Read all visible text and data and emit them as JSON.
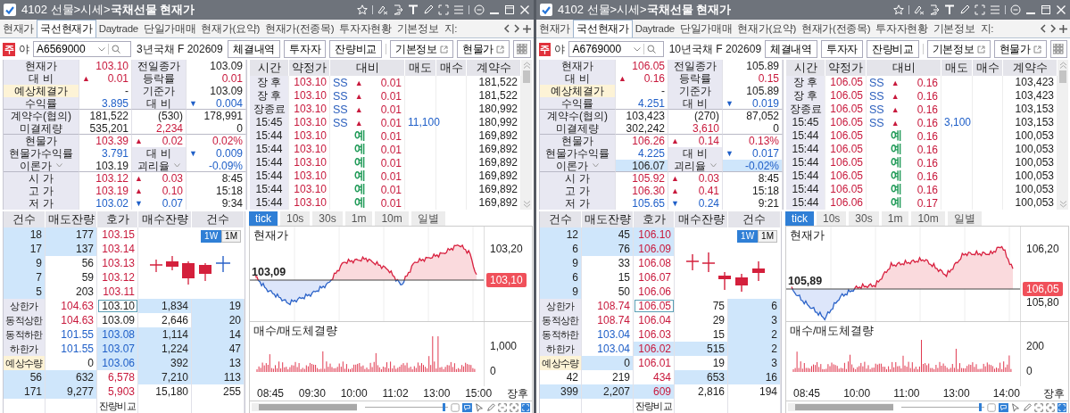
{
  "panels": [
    {
      "title": "4102 선물>시세>**국채선물 현재가**",
      "tabs": [
        {
          "label": "현재가",
          "selected": false
        },
        {
          "label": "국선현재가",
          "selected": true
        },
        {
          "label": "Daytrade",
          "selected": false
        },
        {
          "label": "단일가매매",
          "selected": false
        },
        {
          "label": "현재가(요약)",
          "selected": false
        },
        {
          "label": "현재가(전종목)",
          "selected": false
        },
        {
          "label": "투자자현황",
          "selected": false
        },
        {
          "label": "기본정보",
          "selected": false
        },
        {
          "label": "지:",
          "selected": false
        }
      ],
      "badge": "주",
      "session": "야",
      "code": "A6569000",
      "name": "3년국채 F 202609",
      "buttons": [
        {
          "label": "체결내역",
          "external": false
        },
        {
          "label": "투자자",
          "external": false
        },
        {
          "label": "잔량비교",
          "external": false
        },
        {
          "label": "기본정보",
          "external": true
        },
        {
          "label": "현물가",
          "external": true
        }
      ],
      "info": [
        [
          {
            "text": "현재가",
            "kind": "label"
          },
          {
            "text": "103.10",
            "color": "#c8193c"
          },
          {
            "text": "전일종가",
            "kind": "label"
          },
          {
            "text": "103.09"
          }
        ],
        [
          {
            "text": "대 비",
            "kind": "label"
          },
          {
            "text": "0.01",
            "color": "#c8193c",
            "arrow": "▲"
          },
          {
            "text": "등락률",
            "kind": "label"
          },
          {
            "text": "0.01",
            "color": "#c8193c"
          }
        ],
        [
          {
            "text": "예상체결가",
            "kind": "note"
          },
          {
            "text": "-"
          },
          {
            "text": "기준가",
            "kind": "label"
          },
          {
            "text": "103.09"
          }
        ],
        [
          {
            "text": "수익률",
            "kind": "label"
          },
          {
            "text": "3.895",
            "color": "#1f5fc8"
          },
          {
            "text": "대 비",
            "kind": "label"
          },
          {
            "text": "0.004",
            "color": "#1f5fc8",
            "arrow": "▼"
          }
        ],
        [
          {
            "text": "계약수(협의)",
            "kind": "label"
          },
          {
            "text": "181,522"
          },
          {
            "text": "(530)"
          },
          {
            "text": "178,991"
          }
        ],
        [
          {
            "text": "미결제량",
            "kind": "label"
          },
          {
            "text": "535,201"
          },
          {
            "text": "2,234",
            "color": "#c8193c"
          },
          {
            "text": "0"
          }
        ],
        [
          {
            "text": "현물가",
            "kind": "label"
          },
          {
            "text": "103.39",
            "color": "#c8193c"
          },
          {
            "text": "0.02",
            "color": "#c8193c",
            "arrow": "▲"
          },
          {
            "text": "0.02%",
            "color": "#c8193c"
          }
        ],
        [
          {
            "text": "현물가수익률",
            "kind": "label"
          },
          {
            "text": "3.791",
            "color": "#1f5fc8"
          },
          {
            "text": "대 비",
            "kind": "label"
          },
          {
            "text": "0.009",
            "color": "#1f5fc8",
            "arrow": "▼"
          }
        ],
        [
          {
            "text": "이론가",
            "kind": "label",
            "dropdown": true
          },
          {
            "text": "103.19"
          },
          {
            "text": "괴리율",
            "kind": "label",
            "dropdown": true
          },
          {
            "text": "-0.09%",
            "color": "#1f5fc8"
          }
        ],
        [
          {
            "text": "시 가",
            "kind": "label"
          },
          {
            "text": "103.12",
            "color": "#c8193c"
          },
          {
            "text": "0.03",
            "color": "#c8193c",
            "arrow": "▲"
          },
          {
            "text": "8:45"
          }
        ],
        [
          {
            "text": "고 가",
            "kind": "label"
          },
          {
            "text": "103.19",
            "color": "#c8193c"
          },
          {
            "text": "0.10",
            "color": "#c8193c",
            "arrow": "▲"
          },
          {
            "text": "15:18"
          }
        ],
        [
          {
            "text": "저 가",
            "kind": "label"
          },
          {
            "text": "103.02",
            "color": "#1f5fc8"
          },
          {
            "text": "0.07",
            "color": "#1f5fc8",
            "arrow": "▼"
          },
          {
            "text": "9:34"
          }
        ]
      ],
      "trades": {
        "columns": [
          "시간",
          "약정가",
          "대비",
          "매도",
          "매수",
          "계약수"
        ],
        "rows": [
          {
            "time": "장 후",
            "price": "103.10",
            "color": "#c8193c",
            "flag": {
              "text": "SS",
              "color": "#2b5fbd"
            },
            "arrow": "▲",
            "change": "0.01",
            "volume": "181,522"
          },
          {
            "time": "장 후",
            "price": "103.10",
            "color": "#c8193c",
            "flag": {
              "text": "SS",
              "color": "#2b5fbd"
            },
            "arrow": "▲",
            "change": "0.01",
            "volume": "181,522"
          },
          {
            "time": "장종료",
            "price": "103.10",
            "color": "#c8193c",
            "flag": {
              "text": "SS",
              "color": "#2b5fbd"
            },
            "arrow": "▲",
            "change": "0.01",
            "volume": "180,992"
          },
          {
            "time": "15:45",
            "price": "103.10",
            "color": "#c8193c",
            "flag": {
              "text": "SS",
              "color": "#2b5fbd"
            },
            "arrow": "▲",
            "change": "0.01",
            "sell": "11,100",
            "volume": "180,992"
          },
          {
            "time": "15:44",
            "price": "103.10",
            "color": "#c8193c",
            "flag": {
              "text": "예",
              "color": "#1f9a57"
            },
            "change": "0.01",
            "volume": "169,892"
          },
          {
            "time": "15:44",
            "price": "103.10",
            "color": "#c8193c",
            "flag": {
              "text": "예",
              "color": "#1f9a57"
            },
            "change": "0.01",
            "volume": "169,892"
          },
          {
            "time": "15:44",
            "price": "103.10",
            "color": "#c8193c",
            "flag": {
              "text": "예",
              "color": "#1f9a57"
            },
            "change": "0.01",
            "volume": "169,892"
          },
          {
            "time": "15:44",
            "price": "103.10",
            "color": "#c8193c",
            "flag": {
              "text": "예",
              "color": "#1f9a57"
            },
            "change": "0.01",
            "volume": "169,892"
          },
          {
            "time": "15:44",
            "price": "103.10",
            "color": "#c8193c",
            "flag": {
              "text": "예",
              "color": "#1f9a57"
            },
            "change": "0.01",
            "volume": "169,892"
          },
          {
            "time": "15:44",
            "price": "103.10",
            "color": "#c8193c",
            "flag": {
              "text": "예",
              "color": "#1f9a57"
            },
            "change": "0.01",
            "volume": "169,892"
          }
        ]
      },
      "book": {
        "columns": [
          "건수",
          "매도잔량",
          "호가",
          "매수잔량",
          "건수"
        ],
        "rows": [
          [
            {
              "text": "18",
              "shaded": true
            },
            {
              "text": "177",
              "shaded": true
            },
            {
              "text": "103.15",
              "color": "#c8193c"
            }
          ],
          [
            {
              "text": "17",
              "shaded": true
            },
            {
              "text": "137",
              "shaded": true
            },
            {
              "text": "103.14",
              "color": "#c8193c"
            }
          ],
          [
            {
              "text": "9",
              "shaded": true
            },
            {
              "text": "56"
            },
            {
              "text": "103.13",
              "color": "#c8193c"
            }
          ],
          [
            {
              "text": "7",
              "shaded": true
            },
            {
              "text": "59"
            },
            {
              "text": "103.12",
              "color": "#c8193c"
            }
          ],
          [
            {
              "text": "5",
              "shaded": true
            },
            {
              "text": "203"
            },
            {
              "text": "103.11",
              "color": "#c8193c"
            }
          ],
          [
            {
              "text": "상한가",
              "kind": "label"
            },
            {
              "text": "104.63",
              "color": "#c8193c"
            },
            {
              "text": "103.10",
              "boxed": true
            },
            {
              "text": "1,834",
              "shaded": true
            },
            {
              "text": "19",
              "shaded": true
            }
          ],
          [
            {
              "text": "동적상한",
              "kind": "label"
            },
            {
              "text": "104.63",
              "color": "#c8193c"
            },
            {
              "text": "103.09"
            },
            {
              "text": "2,646"
            },
            {
              "text": "20",
              "shaded": true
            }
          ],
          [
            {
              "text": "동적하한",
              "kind": "label"
            },
            {
              "text": "101.55",
              "color": "#1f5fc8"
            },
            {
              "text": "103.08",
              "color": "#1f5fc8",
              "shaded": true
            },
            {
              "text": "1,114",
              "shaded": true
            },
            {
              "text": "14",
              "shaded": true
            }
          ],
          [
            {
              "text": "하한가",
              "kind": "label"
            },
            {
              "text": "101.55",
              "color": "#1f5fc8"
            },
            {
              "text": "103.07",
              "color": "#1f5fc8",
              "shaded": true
            },
            {
              "text": "1,224",
              "shaded": true
            },
            {
              "text": "47",
              "shaded": true
            }
          ],
          [
            {
              "text": "예상수량",
              "kind": "note"
            },
            {
              "text": "0"
            },
            {
              "text": "103.06",
              "color": "#1f5fc8",
              "shaded": true
            },
            {
              "text": "392",
              "shaded": true
            },
            {
              "text": "13",
              "shaded": true
            }
          ],
          [
            {
              "text": "56",
              "shaded": true
            },
            {
              "text": "632",
              "shaded": true
            },
            {
              "text": "6,578",
              "color": "#c8193c"
            },
            {
              "text": "7,210",
              "shaded": true
            },
            {
              "text": "113",
              "shaded": true
            }
          ],
          [
            {
              "text": "171",
              "shaded": true
            },
            {
              "text": "9,277",
              "shaded": true
            },
            {
              "text": "5,903",
              "color": "#c8193c"
            },
            {
              "text": "15,180"
            },
            {
              "text": "255"
            }
          ],
          [
            null,
            null,
            {
              "text": "잔량비교",
              "kind": "button"
            },
            null,
            null
          ]
        ]
      },
      "range_toggle": [
        {
          "label": "1W",
          "selected": true
        },
        {
          "label": "1M",
          "selected": false
        }
      ],
      "periods": [
        {
          "label": "tick",
          "selected": true
        },
        {
          "label": "10s",
          "selected": false
        },
        {
          "label": "30s",
          "selected": false
        },
        {
          "label": "1m",
          "selected": false
        },
        {
          "label": "10m",
          "selected": false
        },
        {
          "label": "일별",
          "selected": false
        }
      ],
      "chart": {
        "title": "현재가",
        "yticks": [
          "103,20"
        ],
        "base": "103,09",
        "last": "103,10",
        "volume_title": "매수/매도체결량",
        "slider": {
          "level": 0.97
        },
        "volume_ticks": [
          "1,000",
          "0"
        ],
        "times": [
          "08:45",
          "09:30",
          "10:00",
          "11:02",
          "13:00",
          "15:00",
          "장후"
        ]
      }
    },
    {
      "title": "4102 선물>시세>**국채선물 현재가**",
      "tabs": [
        {
          "label": "현재가",
          "selected": false
        },
        {
          "label": "국선현재가",
          "selected": true
        },
        {
          "label": "Daytrade",
          "selected": false
        },
        {
          "label": "단일가매매",
          "selected": false
        },
        {
          "label": "현재가(요약)",
          "selected": false
        },
        {
          "label": "현재가(전종목)",
          "selected": false
        },
        {
          "label": "투자자현황",
          "selected": false
        },
        {
          "label": "기본정보",
          "selected": false
        },
        {
          "label": "지:",
          "selected": false
        }
      ],
      "badge": "주",
      "session": "야",
      "code": "A6769000",
      "name": "10년국채 F 202609",
      "buttons": [
        {
          "label": "체결내역",
          "external": false
        },
        {
          "label": "투자자",
          "external": false
        },
        {
          "label": "잔량비교",
          "external": false
        },
        {
          "label": "기본정보",
          "external": true
        },
        {
          "label": "현물가",
          "external": true
        }
      ],
      "info": [
        [
          {
            "text": "현재가",
            "kind": "label"
          },
          {
            "text": "106.05",
            "color": "#c8193c"
          },
          {
            "text": "전일종가",
            "kind": "label"
          },
          {
            "text": "105.89"
          }
        ],
        [
          {
            "text": "대 비",
            "kind": "label"
          },
          {
            "text": "0.16",
            "color": "#c8193c",
            "arrow": "▲"
          },
          {
            "text": "등락률",
            "kind": "label"
          },
          {
            "text": "0.15",
            "color": "#c8193c"
          }
        ],
        [
          {
            "text": "예상체결가",
            "kind": "note"
          },
          {
            "text": "-"
          },
          {
            "text": "기준가",
            "kind": "label"
          },
          {
            "text": "105.89"
          }
        ],
        [
          {
            "text": "수익률",
            "kind": "label"
          },
          {
            "text": "4.251",
            "color": "#1f5fc8"
          },
          {
            "text": "대 비",
            "kind": "label"
          },
          {
            "text": "0.019",
            "color": "#1f5fc8",
            "arrow": "▼"
          }
        ],
        [
          {
            "text": "계약수(협의)",
            "kind": "label"
          },
          {
            "text": "103,423"
          },
          {
            "text": "(270)"
          },
          {
            "text": "87,052"
          }
        ],
        [
          {
            "text": "미결제량",
            "kind": "label"
          },
          {
            "text": "302,242"
          },
          {
            "text": "3,610",
            "color": "#c8193c"
          },
          {
            "text": "0"
          }
        ],
        [
          {
            "text": "현물가",
            "kind": "label"
          },
          {
            "text": "106.26",
            "color": "#c8193c"
          },
          {
            "text": "0.14",
            "color": "#c8193c",
            "arrow": "▲"
          },
          {
            "text": "0.13%",
            "color": "#c8193c"
          }
        ],
        [
          {
            "text": "현물가수익률",
            "kind": "label"
          },
          {
            "text": "4.225",
            "color": "#1f5fc8"
          },
          {
            "text": "대 비",
            "kind": "label"
          },
          {
            "text": "0.017",
            "color": "#1f5fc8",
            "arrow": "▼"
          }
        ],
        [
          {
            "text": "이론가",
            "kind": "label",
            "dropdown": true
          },
          {
            "text": "106.07",
            "shaded": true
          },
          {
            "text": "괴리율",
            "kind": "label",
            "dropdown": true
          },
          {
            "text": "-0.02%",
            "color": "#1f5fc8",
            "shaded": true
          }
        ],
        [
          {
            "text": "시 가",
            "kind": "label"
          },
          {
            "text": "105.92",
            "color": "#c8193c"
          },
          {
            "text": "0.03",
            "color": "#c8193c",
            "arrow": "▲"
          },
          {
            "text": "8:45"
          }
        ],
        [
          {
            "text": "고 가",
            "kind": "label"
          },
          {
            "text": "106.30",
            "color": "#c8193c"
          },
          {
            "text": "0.41",
            "color": "#c8193c",
            "arrow": "▲"
          },
          {
            "text": "15:18"
          }
        ],
        [
          {
            "text": "저 가",
            "kind": "label"
          },
          {
            "text": "105.65",
            "color": "#1f5fc8"
          },
          {
            "text": "0.24",
            "color": "#1f5fc8",
            "arrow": "▼"
          },
          {
            "text": "9:21"
          }
        ]
      ],
      "trades": {
        "columns": [
          "시간",
          "약정가",
          "대비",
          "매도",
          "매수",
          "계약수"
        ],
        "rows": [
          {
            "time": "장 후",
            "price": "106.05",
            "color": "#c8193c",
            "flag": {
              "text": "SS",
              "color": "#2b5fbd"
            },
            "arrow": "▲",
            "change": "0.16",
            "volume": "103,423"
          },
          {
            "time": "장 후",
            "price": "106.05",
            "color": "#c8193c",
            "flag": {
              "text": "SS",
              "color": "#2b5fbd"
            },
            "arrow": "▲",
            "change": "0.16",
            "volume": "103,423"
          },
          {
            "time": "장종료",
            "price": "106.05",
            "color": "#c8193c",
            "flag": {
              "text": "SS",
              "color": "#2b5fbd"
            },
            "arrow": "▲",
            "change": "0.16",
            "volume": "103,153"
          },
          {
            "time": "15:45",
            "price": "106.05",
            "color": "#c8193c",
            "flag": {
              "text": "SS",
              "color": "#2b5fbd"
            },
            "arrow": "▲",
            "change": "0.16",
            "sell": "3,100",
            "volume": "103,153"
          },
          {
            "time": "15:44",
            "price": "106.05",
            "color": "#c8193c",
            "flag": {
              "text": "예",
              "color": "#1f9a57"
            },
            "change": "0.16",
            "volume": "100,053"
          },
          {
            "time": "15:44",
            "price": "106.05",
            "color": "#c8193c",
            "flag": {
              "text": "예",
              "color": "#1f9a57"
            },
            "change": "0.16",
            "volume": "100,053"
          },
          {
            "time": "15:44",
            "price": "106.05",
            "color": "#c8193c",
            "flag": {
              "text": "예",
              "color": "#1f9a57"
            },
            "change": "0.16",
            "volume": "100,053"
          },
          {
            "time": "15:44",
            "price": "106.05",
            "color": "#c8193c",
            "flag": {
              "text": "예",
              "color": "#1f9a57"
            },
            "change": "0.16",
            "volume": "100,053"
          },
          {
            "time": "15:44",
            "price": "106.05",
            "color": "#c8193c",
            "flag": {
              "text": "예",
              "color": "#1f9a57"
            },
            "change": "0.16",
            "volume": "100,053"
          },
          {
            "time": "15:44",
            "price": "106.06",
            "color": "#c8193c",
            "flag": {
              "text": "예",
              "color": "#1f9a57"
            },
            "change": "0.17",
            "volume": "100,053"
          }
        ]
      },
      "book": {
        "columns": [
          "건수",
          "매도잔량",
          "호가",
          "매수잔량",
          "건수"
        ],
        "rows": [
          [
            {
              "text": "12",
              "shaded": true
            },
            {
              "text": "45",
              "shaded": true
            },
            {
              "text": "106.10",
              "color": "#c8193c",
              "shaded": true
            }
          ],
          [
            {
              "text": "6",
              "shaded": true
            },
            {
              "text": "76",
              "shaded": true
            },
            {
              "text": "106.09",
              "color": "#c8193c",
              "shaded": true
            }
          ],
          [
            {
              "text": "9",
              "shaded": true
            },
            {
              "text": "33"
            },
            {
              "text": "106.08",
              "color": "#c8193c"
            }
          ],
          [
            {
              "text": "6",
              "shaded": true
            },
            {
              "text": "15"
            },
            {
              "text": "106.07",
              "color": "#c8193c"
            }
          ],
          [
            {
              "text": "9",
              "shaded": true
            },
            {
              "text": "50"
            },
            {
              "text": "106.06",
              "color": "#c8193c"
            }
          ],
          [
            {
              "text": "상한가",
              "kind": "label"
            },
            {
              "text": "108.74",
              "color": "#c8193c"
            },
            {
              "text": "106.05",
              "color": "#c8193c",
              "boxed": true
            },
            {
              "text": "75"
            },
            {
              "text": "6",
              "shaded": true
            }
          ],
          [
            {
              "text": "동적상한",
              "kind": "label"
            },
            {
              "text": "108.74",
              "color": "#c8193c"
            },
            {
              "text": "106.04",
              "color": "#c8193c"
            },
            {
              "text": "29"
            },
            {
              "text": "3",
              "shaded": true
            }
          ],
          [
            {
              "text": "동적하한",
              "kind": "label"
            },
            {
              "text": "103.04",
              "color": "#1f5fc8"
            },
            {
              "text": "106.03",
              "color": "#c8193c"
            },
            {
              "text": "15"
            },
            {
              "text": "2",
              "shaded": true
            }
          ],
          [
            {
              "text": "하한가",
              "kind": "label"
            },
            {
              "text": "103.04",
              "color": "#1f5fc8"
            },
            {
              "text": "106.02",
              "color": "#c8193c",
              "shaded": true
            },
            {
              "text": "515",
              "shaded": true
            },
            {
              "text": "2",
              "shaded": true
            }
          ],
          [
            {
              "text": "예상수량",
              "kind": "note"
            },
            {
              "text": "0",
              "shaded": true
            },
            {
              "text": "106.01",
              "color": "#c8193c"
            },
            {
              "text": "19"
            },
            {
              "text": "3",
              "shaded": true
            }
          ],
          [
            {
              "text": "42"
            },
            {
              "text": "219"
            },
            {
              "text": "434",
              "color": "#c8193c"
            },
            {
              "text": "653",
              "shaded": true
            },
            {
              "text": "16",
              "shaded": true
            }
          ],
          [
            {
              "text": "399",
              "shaded": true
            },
            {
              "text": "2,207",
              "shaded": true
            },
            {
              "text": "609",
              "color": "#c8193c",
              "shaded": true
            },
            {
              "text": "2,816"
            },
            {
              "text": "194"
            }
          ],
          [
            null,
            null,
            {
              "text": "잔량비교",
              "kind": "button"
            },
            null,
            null
          ]
        ]
      },
      "range_toggle": [
        {
          "label": "1W",
          "selected": true
        },
        {
          "label": "1M",
          "selected": false
        }
      ],
      "periods": [
        {
          "label": "tick",
          "selected": true
        },
        {
          "label": "10s",
          "selected": false
        },
        {
          "label": "30s",
          "selected": false
        },
        {
          "label": "1m",
          "selected": false
        },
        {
          "label": "10m",
          "selected": false
        },
        {
          "label": "일별",
          "selected": false
        }
      ],
      "chart": {
        "title": "현재가",
        "yticks": [
          "106,20",
          "105,80"
        ],
        "base": "105,89",
        "last": "106,05",
        "volume_title": "매수/매도체결량",
        "slider": {
          "level": 0.97
        },
        "volume_ticks": [
          "200",
          "0"
        ],
        "times": [
          "08:45",
          "10:00",
          "11:00",
          "13:00",
          "14:00",
          "장후"
        ]
      }
    }
  ]
}
